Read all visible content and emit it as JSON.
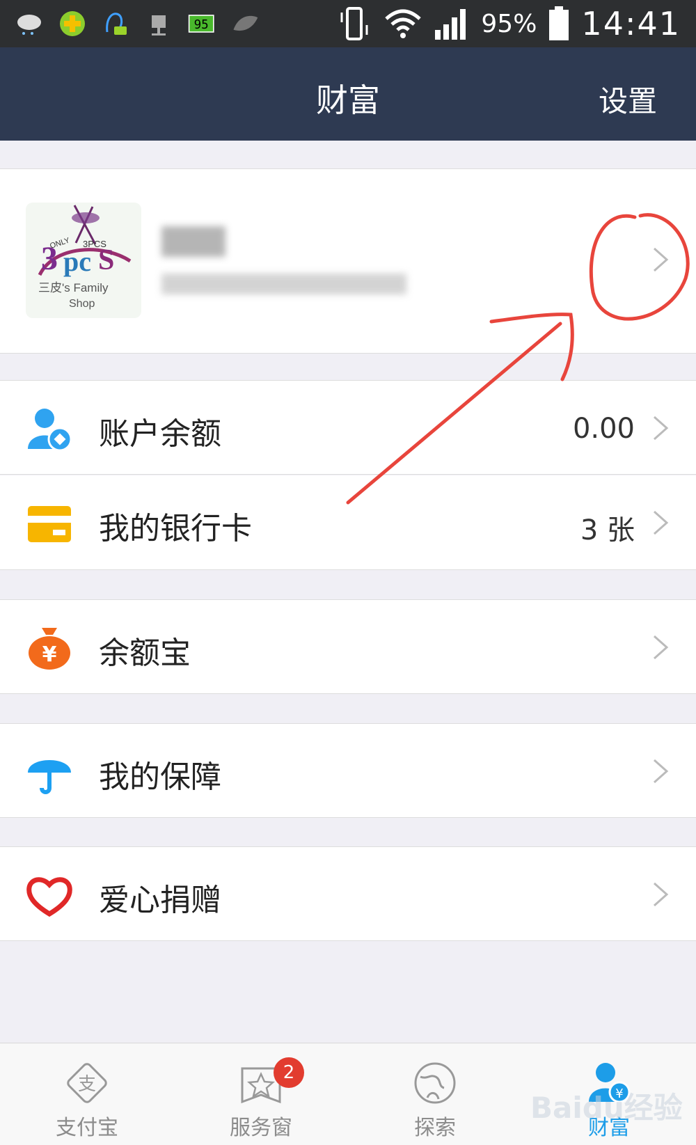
{
  "status_bar": {
    "battery_percent": "95%",
    "time": "14:41"
  },
  "nav": {
    "title": "财富",
    "settings": "设置"
  },
  "profile": {
    "avatar_text_lines": [
      "ONLY",
      "3PCS",
      "三皮's Family",
      "Shop"
    ]
  },
  "menu": [
    {
      "label": "账户余额",
      "value": "0.00",
      "icon": "user-balance-icon",
      "color": "#2fa3f0"
    },
    {
      "label": "我的银行卡",
      "value": "3 张",
      "icon": "bank-card-icon",
      "color": "#f7b500"
    },
    {
      "label": "余额宝",
      "value": "",
      "icon": "money-bag-icon",
      "color": "#f26a1b"
    },
    {
      "label": "我的保障",
      "value": "",
      "icon": "umbrella-icon",
      "color": "#1da0f2"
    },
    {
      "label": "爱心捐赠",
      "value": "",
      "icon": "heart-icon",
      "color": "#e02828"
    }
  ],
  "tabs": [
    {
      "label": "支付宝",
      "icon": "alipay-icon",
      "active": false
    },
    {
      "label": "服务窗",
      "icon": "service-window-icon",
      "active": false,
      "badge": "2"
    },
    {
      "label": "探索",
      "icon": "explore-icon",
      "active": false
    },
    {
      "label": "财富",
      "icon": "wealth-icon",
      "active": true
    }
  ],
  "watermark": "Baidu经验",
  "annotation_color": "#e8453c"
}
